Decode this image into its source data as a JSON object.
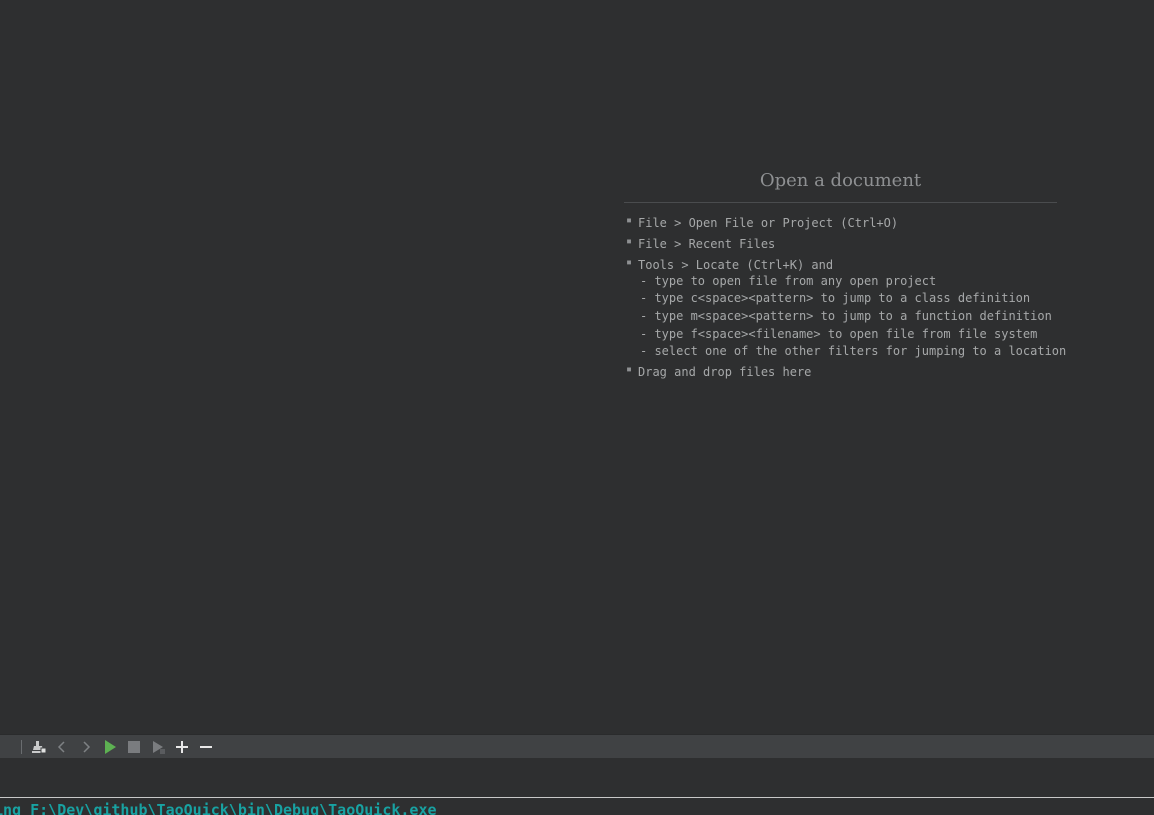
{
  "welcome": {
    "title": "Open a document",
    "hints": [
      "File > Open File or Project (Ctrl+O)",
      "File > Recent Files",
      "Tools > Locate (Ctrl+K) and"
    ],
    "locate_subitems": [
      "- type to open file from any open project",
      "- type c<space><pattern> to jump to a class definition",
      "- type m<space><pattern> to jump to a function definition",
      "- type f<space><filename> to open file from file system",
      "- select one of the other filters for jumping to a location"
    ],
    "drag_hint": "Drag and drop files here"
  },
  "toolbar": {
    "icons": [
      "clear-icon",
      "previous-icon",
      "next-icon",
      "run-icon",
      "stop-icon",
      "attach-icon",
      "zoom-in-icon",
      "zoom-out-icon"
    ],
    "run_color": "#5db152"
  },
  "output": {
    "text": "ing F:\\Dev\\github\\TaoQuick\\bin\\Debug\\TaoQuick.exe"
  }
}
